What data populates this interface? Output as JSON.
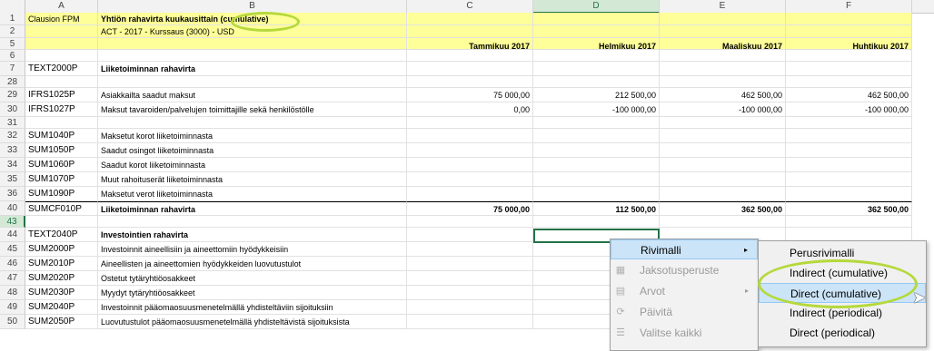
{
  "columns": [
    "A",
    "B",
    "C",
    "D",
    "E",
    "F"
  ],
  "rows": [
    {
      "num": "1",
      "a": "Clausion FPM",
      "b": "Yhtiön rahavirta kuukausittain (cumulative)",
      "c": "",
      "d": "",
      "e": "",
      "f": ""
    },
    {
      "num": "2",
      "a": "",
      "b": "ACT - 2017 - Kurssaus (3000) - USD",
      "c": "",
      "d": "",
      "e": "",
      "f": ""
    },
    {
      "num": "5",
      "a": "",
      "b": "",
      "c": "Tammikuu 2017",
      "d": "Helmikuu 2017",
      "e": "Maaliskuu 2017",
      "f": "Huhtikuu 2017"
    },
    {
      "num": "6",
      "a": "",
      "b": "",
      "c": "",
      "d": "",
      "e": "",
      "f": ""
    },
    {
      "num": "7",
      "a": "TEXT2000P",
      "b": "Liiketoiminnan rahavirta",
      "c": "",
      "d": "",
      "e": "",
      "f": ""
    },
    {
      "num": "28",
      "a": "",
      "b": "",
      "c": "",
      "d": "",
      "e": "",
      "f": ""
    },
    {
      "num": "29",
      "a": "IFRS1025P",
      "b": "Asiakkailta saadut maksut",
      "c": "75 000,00",
      "d": "212 500,00",
      "e": "462 500,00",
      "f": "462 500,00"
    },
    {
      "num": "30",
      "a": "IFRS1027P",
      "b": "Maksut tavaroiden/palvelujen toimittajille sekä henkilöstölle",
      "c": "0,00",
      "d": "-100 000,00",
      "e": "-100 000,00",
      "f": "-100 000,00"
    },
    {
      "num": "31",
      "a": "",
      "b": "",
      "c": "",
      "d": "",
      "e": "",
      "f": ""
    },
    {
      "num": "32",
      "a": "SUM1040P",
      "b": "Maksetut korot liiketoiminnasta",
      "c": "",
      "d": "",
      "e": "",
      "f": ""
    },
    {
      "num": "33",
      "a": "SUM1050P",
      "b": "Saadut osingot liiketoiminnasta",
      "c": "",
      "d": "",
      "e": "",
      "f": ""
    },
    {
      "num": "34",
      "a": "SUM1060P",
      "b": "Saadut korot liiketoiminnasta",
      "c": "",
      "d": "",
      "e": "",
      "f": ""
    },
    {
      "num": "35",
      "a": "SUM1070P",
      "b": "Muut rahoituserät liiketoiminnasta",
      "c": "",
      "d": "",
      "e": "",
      "f": ""
    },
    {
      "num": "36",
      "a": "SUM1090P",
      "b": "Maksetut verot liiketoiminnasta",
      "c": "",
      "d": "",
      "e": "",
      "f": ""
    },
    {
      "num": "40",
      "a": "SUMCF010P",
      "b": "Liiketoiminnan rahavirta",
      "c": "75 000,00",
      "d": "112 500,00",
      "e": "362 500,00",
      "f": "362 500,00"
    },
    {
      "num": "43",
      "a": "",
      "b": "",
      "c": "",
      "d": "",
      "e": "",
      "f": ""
    },
    {
      "num": "44",
      "a": "TEXT2040P",
      "b": "Investointien rahavirta",
      "c": "",
      "d": "",
      "e": "",
      "f": ""
    },
    {
      "num": "45",
      "a": "SUM2000P",
      "b": "Investoinnit aineellisiin ja aineettomiin hyödykkeisiin",
      "c": "",
      "d": "",
      "e": "",
      "f": ""
    },
    {
      "num": "46",
      "a": "SUM2010P",
      "b": "Aineellisten ja aineettomien hyödykkeiden luovutustulot",
      "c": "",
      "d": "",
      "e": "",
      "f": ""
    },
    {
      "num": "47",
      "a": "SUM2020P",
      "b": "Ostetut tytäryhtiöosakkeet",
      "c": "",
      "d": "",
      "e": "",
      "f": ""
    },
    {
      "num": "48",
      "a": "SUM2030P",
      "b": "Myydyt tytäryhtiöosakkeet",
      "c": "",
      "d": "",
      "e": "",
      "f": ""
    },
    {
      "num": "49",
      "a": "SUM2040P",
      "b": "Investoinnit pääomaosuusmenetelmällä yhdisteltäviin sijoituksiin",
      "c": "",
      "d": "",
      "e": "",
      "f": ""
    },
    {
      "num": "50",
      "a": "SUM2050P",
      "b": "Luovutustulot pääomaosuusmenetelmällä yhdisteltävistä sijoituksista",
      "c": "",
      "d": "",
      "e": "",
      "f": ""
    }
  ],
  "context_menu": {
    "items": [
      {
        "label": "Rivimalli",
        "icon": "none",
        "submenu_arrow": "▸"
      },
      {
        "label": "Jaksotusperuste",
        "icon": "grid-icon"
      },
      {
        "label": "Arvot",
        "icon": "table-icon",
        "submenu_arrow": "▸"
      },
      {
        "label": "Päivitä",
        "icon": "refresh-icon"
      },
      {
        "label": "Valitse kaikki",
        "icon": "checklist-icon"
      }
    ]
  },
  "submenu": {
    "items": [
      {
        "label": "Perusrivimalli"
      },
      {
        "label": "Indirect (cumulative)"
      },
      {
        "label": "Direct (cumulative)"
      },
      {
        "label": "Indirect (periodical)"
      },
      {
        "label": "Direct (periodical)"
      }
    ]
  },
  "colors": {
    "highlight_oval": "#b5d93a",
    "selection_green": "#217346",
    "header_yellow": "#ffff99",
    "menu_highlight": "#cce4f7"
  }
}
